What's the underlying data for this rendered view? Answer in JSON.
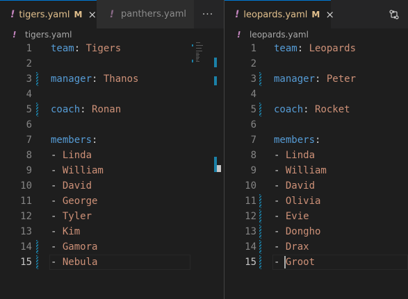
{
  "left": {
    "tabs": [
      {
        "file_icon": "!",
        "label": "tigers.yaml",
        "status": "M",
        "close": "×",
        "active": true
      },
      {
        "file_icon": "!",
        "label": "panthers.yaml",
        "active": false
      }
    ],
    "more_actions": "···",
    "breadcrumb": {
      "file_icon": "!",
      "label": "tigers.yaml"
    },
    "lines": [
      {
        "n": "1",
        "key": "team",
        "sep": ": ",
        "val": "Tigers"
      },
      {
        "n": "2"
      },
      {
        "n": "3",
        "key": "manager",
        "sep": ": ",
        "val": "Thanos",
        "changed": true
      },
      {
        "n": "4"
      },
      {
        "n": "5",
        "key": "coach",
        "sep": ": ",
        "val": "Ronan",
        "changed": true
      },
      {
        "n": "6"
      },
      {
        "n": "7",
        "key": "members",
        "sep": ":"
      },
      {
        "n": "8",
        "dash": "- ",
        "val": "Linda"
      },
      {
        "n": "9",
        "dash": "- ",
        "val": "William"
      },
      {
        "n": "10",
        "dash": "- ",
        "val": "David"
      },
      {
        "n": "11",
        "dash": "- ",
        "val": "George"
      },
      {
        "n": "12",
        "dash": "- ",
        "val": "Tyler"
      },
      {
        "n": "13",
        "dash": "- ",
        "val": "Kim"
      },
      {
        "n": "14",
        "dash": "- ",
        "val": "Gamora",
        "changed": true
      },
      {
        "n": "15",
        "dash": "- ",
        "val": "Nebula",
        "changed": true,
        "current": true
      }
    ]
  },
  "right": {
    "tabs": [
      {
        "file_icon": "!",
        "label": "leopards.yaml",
        "status": "M",
        "close": "×",
        "active": true
      }
    ],
    "compare_icon": "compare-changes-icon",
    "breadcrumb": {
      "file_icon": "!",
      "label": "leopards.yaml"
    },
    "lines": [
      {
        "n": "1",
        "key": "team",
        "sep": ": ",
        "val": "Leopards"
      },
      {
        "n": "2"
      },
      {
        "n": "3",
        "key": "manager",
        "sep": ": ",
        "val": "Peter",
        "changed": true
      },
      {
        "n": "4"
      },
      {
        "n": "5",
        "key": "coach",
        "sep": ": ",
        "val": "Rocket",
        "changed": true
      },
      {
        "n": "6"
      },
      {
        "n": "7",
        "key": "members",
        "sep": ":"
      },
      {
        "n": "8",
        "dash": "- ",
        "val": "Linda"
      },
      {
        "n": "9",
        "dash": "- ",
        "val": "William"
      },
      {
        "n": "10",
        "dash": "- ",
        "val": "David"
      },
      {
        "n": "11",
        "dash": "- ",
        "val": "Olivia",
        "changed": true
      },
      {
        "n": "12",
        "dash": "- ",
        "val": "Evie",
        "changed": true
      },
      {
        "n": "13",
        "dash": "- ",
        "val": "Dongho",
        "changed": true
      },
      {
        "n": "14",
        "dash": "- ",
        "val": "Drax",
        "changed": true
      },
      {
        "n": "15",
        "dash": "- ",
        "val": "Groot",
        "changed": true,
        "current": true
      }
    ]
  },
  "colors": {
    "key": "#569cd6",
    "value": "#ce9178",
    "punct": "#d4d4d4",
    "modified": "#e2c08d",
    "gutter_change": "#1b81a8",
    "yaml_icon": "#c586c0"
  }
}
